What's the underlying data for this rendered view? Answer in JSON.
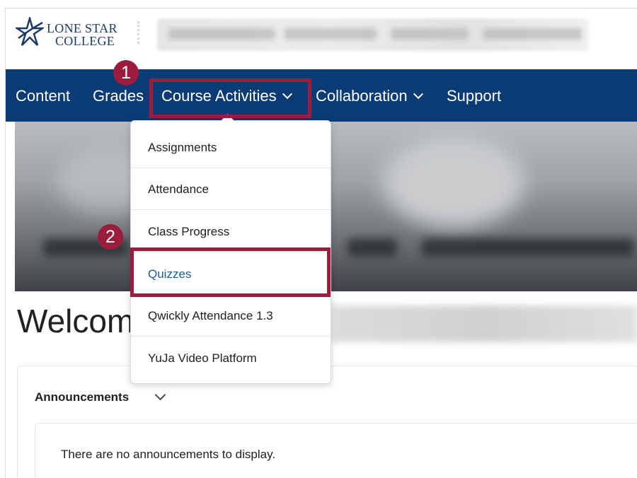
{
  "logo": {
    "line1": "LONE STAR",
    "line2": "COLLEGE"
  },
  "nav": {
    "items": [
      "Content",
      "Grades",
      "Course Activities",
      "Collaboration",
      "Support"
    ]
  },
  "steps": {
    "one": "1",
    "two": "2"
  },
  "dropdown": {
    "items": [
      "Assignments",
      "Attendance",
      "Class Progress",
      "Quizzes",
      "Qwickly Attendance 1.3",
      "YuJa Video Platform"
    ]
  },
  "welcome": {
    "prefix": "Welcom"
  },
  "announcements": {
    "title": "Announcements",
    "empty_text": "There are no announcements to display."
  },
  "colors": {
    "nav_bg": "#0a3b74",
    "highlight": "#9c1c3d",
    "link": "#1a5a94"
  }
}
